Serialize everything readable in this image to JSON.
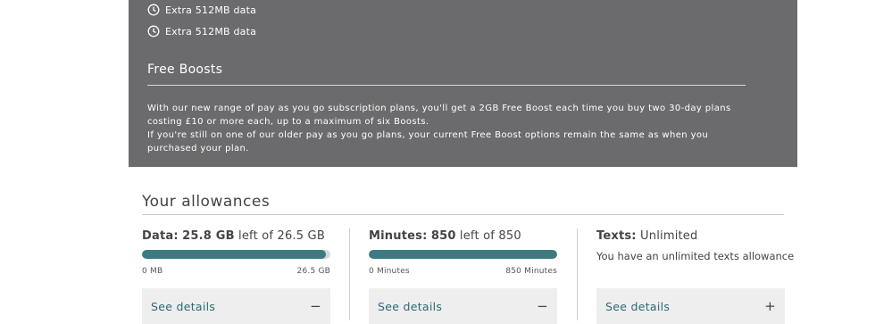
{
  "extras": [
    {
      "label": "Extra 512MB data",
      "icon": "clock-icon"
    },
    {
      "label": "Extra 512MB data",
      "icon": "clock-icon"
    }
  ],
  "free_boosts": {
    "title": "Free Boosts",
    "paragraph1": "With our new range of pay as you go subscription plans, you'll get a 2GB Free Boost each time you buy two 30-day plans costing £10 or more each, up to a maximum of six Boosts.",
    "paragraph2": "If you're still on one of our older pay as you go plans, your current Free Boost options remain the same as when you purchased your plan."
  },
  "allowances": {
    "title": "Your allowances",
    "data": {
      "label": "Data:",
      "amount": "25.8 GB",
      "suffix": "left of 26.5 GB",
      "fraction": 0.974,
      "min_label": "0 MB",
      "max_label": "26.5 GB",
      "details_label": "See details",
      "toggle": "−"
    },
    "minutes": {
      "label": "Minutes:",
      "amount": "850",
      "suffix": "left of 850",
      "fraction": 1.0,
      "min_label": "0 Minutes",
      "max_label": "850 Minutes",
      "details_label": "See details",
      "toggle": "−"
    },
    "texts": {
      "label": "Texts:",
      "amount": "Unlimited",
      "note": "You have an unlimited texts allowance",
      "details_label": "See details",
      "toggle": "+"
    }
  },
  "colors": {
    "panel": "#6b6b6d",
    "bar_fill": "#3d7b80",
    "bar_track": "#d8d8d8",
    "link": "#2a6a73"
  }
}
